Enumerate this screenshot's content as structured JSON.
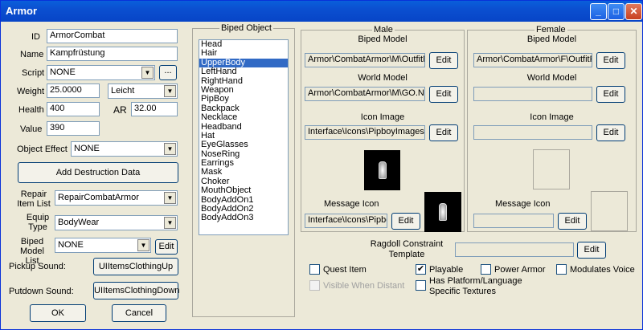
{
  "window": {
    "title": "Armor"
  },
  "fields": {
    "id_label": "ID",
    "id_value": "ArmorCombat",
    "name_label": "Name",
    "name_value": "Kampfrüstung",
    "script_label": "Script",
    "script_value": "NONE",
    "script_btn": "...",
    "weight_label": "Weight",
    "weight_value": "25.0000",
    "weight_class": "Leicht",
    "health_label": "Health",
    "health_value": "400",
    "ar_label": "AR",
    "ar_value": "32.00",
    "value_label": "Value",
    "value_value": "390",
    "object_effect_label": "Object Effect",
    "object_effect_value": "NONE",
    "add_destruction_btn": "Add Destruction Data",
    "repair_label": "Repair\nItem List",
    "repair_value": "RepairCombatArmor",
    "equip_label": "Equip\nType",
    "equip_value": "BodyWear",
    "biped_model_list_label": "Biped\nModel List",
    "biped_model_list_value": "NONE",
    "biped_model_list_edit": "Edit",
    "pickup_label": "Pickup Sound:",
    "pickup_value": "UIItemsClothingUp",
    "putdown_label": "Putdown Sound:",
    "putdown_value": "UIItemsClothingDown",
    "ok": "OK",
    "cancel": "Cancel"
  },
  "biped_object": {
    "title": "Biped Object",
    "items": [
      "Head",
      "Hair",
      "UpperBody",
      "LeftHand",
      "RightHand",
      "Weapon",
      "PipBoy",
      "Backpack",
      "Necklace",
      "Headband",
      "Hat",
      "EyeGlasses",
      "NoseRing",
      "Earrings",
      "Mask",
      "Choker",
      "MouthObject",
      "BodyAddOn1",
      "BodyAddOn2",
      "BodyAddOn3"
    ],
    "selected": "UpperBody"
  },
  "male": {
    "title": "Male",
    "biped_model_label": "Biped Model",
    "biped_model_value": "Armor\\CombatArmor\\M\\OutfitM.",
    "world_model_label": "World Model",
    "world_model_value": "Armor\\CombatArmor\\M\\GO.NIF",
    "icon_image_label": "Icon Image",
    "icon_image_value": "Interface\\Icons\\PipboyImages\\",
    "message_icon_label": "Message Icon",
    "message_icon_value": "Interface\\Icons\\Pipbo",
    "edit": "Edit"
  },
  "female": {
    "title": "Female",
    "biped_model_label": "Biped Model",
    "biped_model_value": "Armor\\CombatArmor\\F\\OutfitF.ni",
    "world_model_label": "World Model",
    "world_model_value": "",
    "icon_image_label": "Icon Image",
    "icon_image_value": "",
    "message_icon_label": "Message Icon",
    "message_icon_value": "",
    "edit": "Edit"
  },
  "ragdoll": {
    "label": "Ragdoll Constraint\nTemplate",
    "value": "",
    "edit": "Edit"
  },
  "checkboxes": {
    "quest_item": {
      "label": "Quest Item",
      "checked": false
    },
    "playable": {
      "label": "Playable",
      "checked": true
    },
    "power_armor": {
      "label": "Power Armor",
      "checked": false
    },
    "modulates_voice": {
      "label": "Modulates Voice",
      "checked": false
    },
    "visible_distant": {
      "label": "Visible When Distant",
      "checked": false
    },
    "platform_textures": {
      "label": "Has Platform/Language\nSpecific Textures",
      "checked": false
    }
  }
}
